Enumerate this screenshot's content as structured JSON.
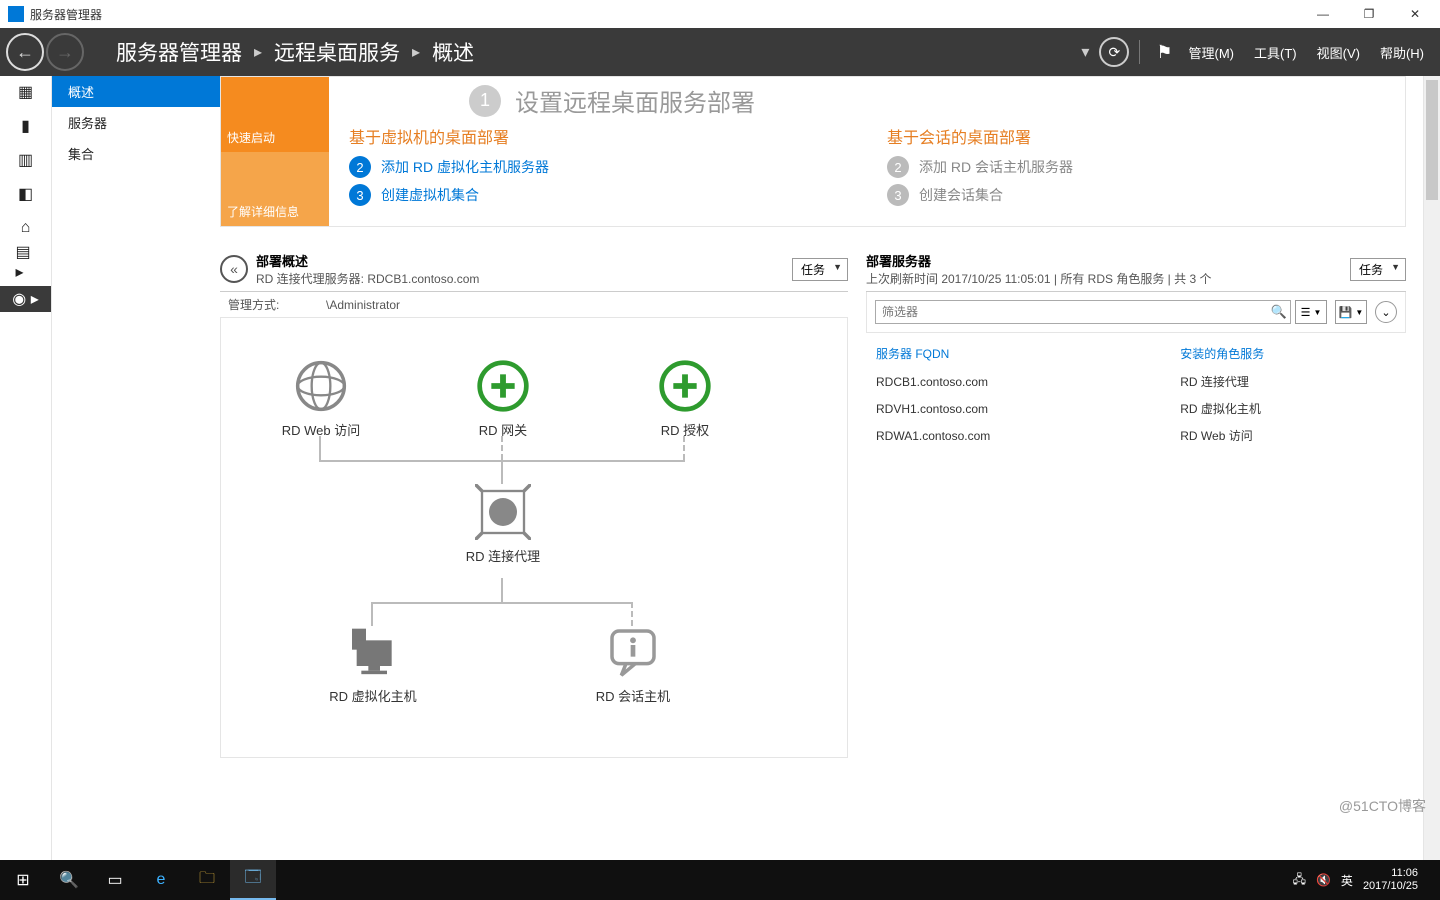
{
  "window": {
    "title": "服务器管理器"
  },
  "breadcrumb": {
    "root": "服务器管理器",
    "level1": "远程桌面服务",
    "level2": "概述"
  },
  "menus": {
    "manage": "管理(M)",
    "tools": "工具(T)",
    "view": "视图(V)",
    "help": "帮助(H)"
  },
  "sidebar": {
    "items": [
      "概述",
      "服务器",
      "集合"
    ]
  },
  "quickstart": {
    "tile1": "快速启动",
    "tile2": "了解详细信息",
    "big_step_num": "1",
    "big_step_label": "设置远程桌面服务部署",
    "left_heading": "基于虚拟机的桌面部署",
    "right_heading": "基于会话的桌面部署",
    "left_steps": [
      {
        "n": "2",
        "label": "添加 RD 虚拟化主机服务器"
      },
      {
        "n": "3",
        "label": "创建虚拟机集合"
      }
    ],
    "right_steps": [
      {
        "n": "2",
        "label": "添加 RD 会话主机服务器"
      },
      {
        "n": "3",
        "label": "创建会话集合"
      }
    ]
  },
  "deploy": {
    "title": "部署概述",
    "sub": "RD 连接代理服务器: RDCB1.contoso.com",
    "tasks_label": "任务",
    "managed_by_label": "管理方式:",
    "managed_by_value": "\\Administrator",
    "nodes": {
      "web": "RD Web 访问",
      "gateway": "RD 网关",
      "license": "RD 授权",
      "broker": "RD 连接代理",
      "virthost": "RD 虚拟化主机",
      "sessionhost": "RD 会话主机"
    }
  },
  "servers": {
    "title": "部署服务器",
    "sub": "上次刷新时间 2017/10/25 11:05:01 | 所有 RDS 角色服务  | 共 3 个",
    "tasks_label": "任务",
    "filter_placeholder": "筛选器",
    "cols": {
      "fqdn": "服务器 FQDN",
      "role": "安装的角色服务"
    },
    "rows": [
      {
        "fqdn": "RDCB1.contoso.com",
        "role": "RD 连接代理"
      },
      {
        "fqdn": "RDVH1.contoso.com",
        "role": "RD 虚拟化主机"
      },
      {
        "fqdn": "RDWA1.contoso.com",
        "role": "RD Web 访问"
      }
    ]
  },
  "tray": {
    "ime": "英",
    "watermark": "@51CTO博客",
    "time": "11:06",
    "date": "2017/10/25"
  }
}
